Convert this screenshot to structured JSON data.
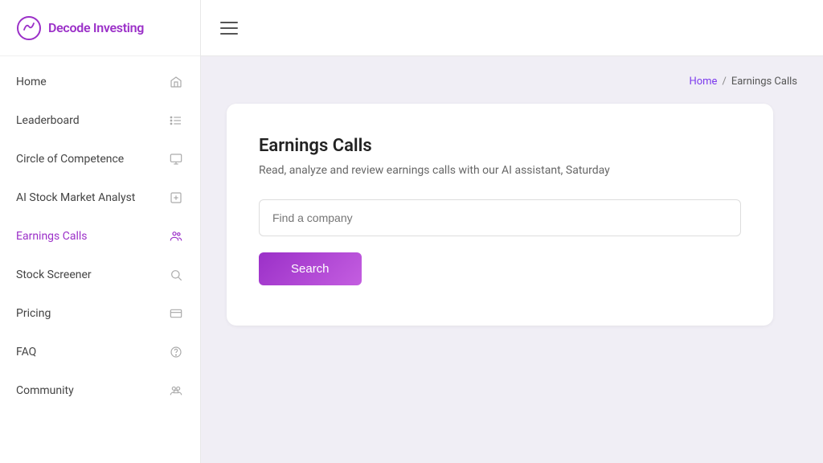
{
  "app": {
    "logo_text": "Decode Investing",
    "logo_icon": "chart-icon"
  },
  "sidebar": {
    "items": [
      {
        "id": "home",
        "label": "Home",
        "icon": "home-icon",
        "active": false
      },
      {
        "id": "leaderboard",
        "label": "Leaderboard",
        "icon": "list-icon",
        "active": false
      },
      {
        "id": "circle-of-competence",
        "label": "Circle of Competence",
        "icon": "monitor-icon",
        "active": false
      },
      {
        "id": "ai-stock-market-analyst",
        "label": "AI Stock Market Analyst",
        "icon": "plus-box-icon",
        "active": false
      },
      {
        "id": "earnings-calls",
        "label": "Earnings Calls",
        "icon": "people-icon",
        "active": true
      },
      {
        "id": "stock-screener",
        "label": "Stock Screener",
        "icon": "search-icon",
        "active": false
      },
      {
        "id": "pricing",
        "label": "Pricing",
        "icon": "card-icon",
        "active": false
      },
      {
        "id": "faq",
        "label": "FAQ",
        "icon": "question-icon",
        "active": false
      },
      {
        "id": "community",
        "label": "Community",
        "icon": "community-icon",
        "active": false
      }
    ]
  },
  "breadcrumb": {
    "home_label": "Home",
    "separator": "/",
    "current_label": "Earnings Calls"
  },
  "main": {
    "card": {
      "title": "Earnings Calls",
      "subtitle": "Read, analyze and review earnings calls with our AI assistant, Saturday",
      "search_placeholder": "Find a company",
      "search_button_label": "Search"
    }
  }
}
